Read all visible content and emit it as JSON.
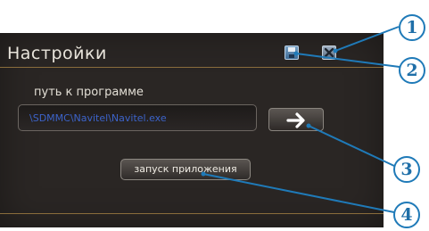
{
  "window": {
    "title": "Настройки",
    "save_icon": "save-icon",
    "close_icon": "close-icon"
  },
  "path_section": {
    "label": "путь к программе",
    "value": "\\SDMMC\\Navitel\\Navitel.exe",
    "browse_icon": "arrow-right-icon"
  },
  "launch_button": {
    "label": "запуск приложения"
  },
  "callouts": [
    "1",
    "2",
    "3",
    "4"
  ],
  "colors": {
    "panel": "#2a2624",
    "accent_line": "#8a6d3c",
    "path_text": "#3c63c9",
    "callout": "#1f7ab8"
  }
}
